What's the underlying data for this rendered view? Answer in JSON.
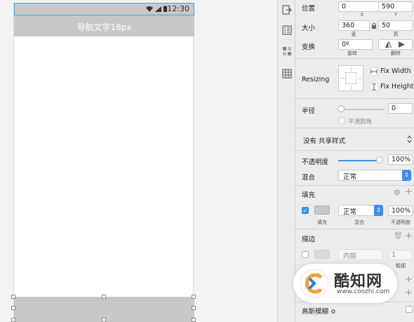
{
  "artboard": {
    "status_time": "12:30",
    "nav_title": "导航文字18px"
  },
  "inspector": {
    "position": {
      "label": "位置",
      "x": "0",
      "y": "590",
      "x_label": "X",
      "y_label": "Y"
    },
    "size": {
      "label": "大小",
      "width": "360",
      "height": "50",
      "w_label": "宽",
      "h_label": "高"
    },
    "transform": {
      "label": "变换",
      "rotate": "0º",
      "rotate_label": "旋转",
      "flip_label": "翻转"
    },
    "resizing": {
      "label": "Resizing",
      "fix_width": "Fix Width",
      "fix_height": "Fix Height"
    },
    "radius": {
      "label": "半径",
      "value": "0",
      "smooth_label": "平滑圆角"
    },
    "shared_style": {
      "value": "没有 共享样式"
    },
    "opacity": {
      "label": "不透明度",
      "value": "100%"
    },
    "blend": {
      "label": "混合",
      "value": "正常"
    },
    "fills": {
      "header": "填充",
      "mode": "正常",
      "opacity": "100%",
      "swatch_label": "填充",
      "mode_label": "混合",
      "opacity_label": "不透明度"
    },
    "borders": {
      "header": "描边",
      "position": "内部",
      "width": "1",
      "width_label": "粗细"
    },
    "blur": {
      "value": "高斯模糊 ≎"
    }
  },
  "watermark": {
    "title": "酷知网",
    "url": "www.coozhi.com"
  },
  "colors": {
    "accent": "#3b8ef0",
    "selection": "#4aa3df",
    "bar_gray": "#c8c8c8"
  }
}
